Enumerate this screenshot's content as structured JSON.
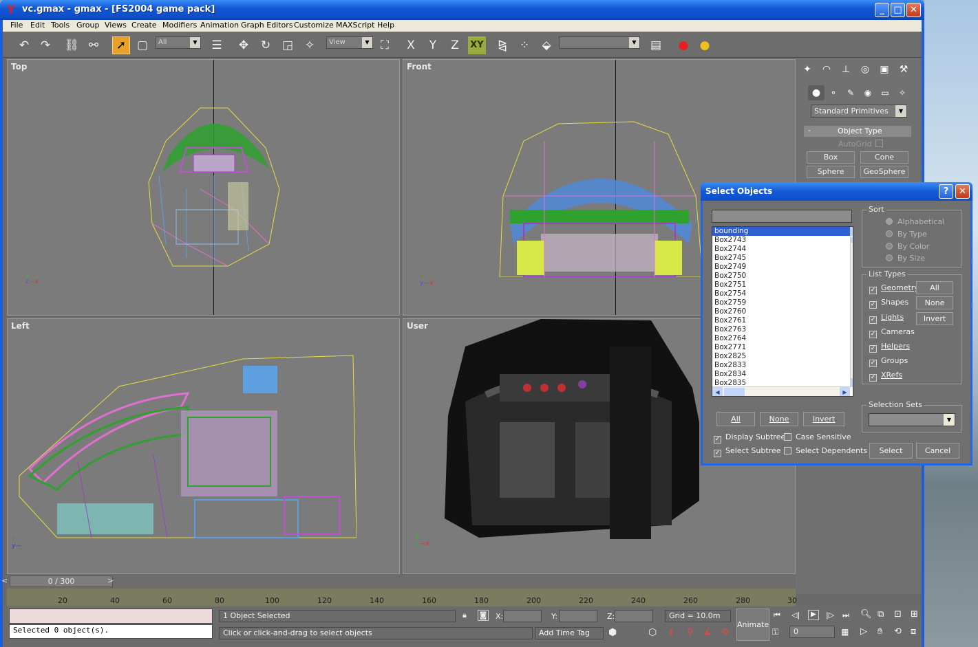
{
  "window": {
    "title": "vc.gmax - gmax - [FS2004 game pack]",
    "min_glyph": "_",
    "max_glyph": "□",
    "close_glyph": "✕"
  },
  "menu": [
    "File",
    "Edit",
    "Tools",
    "Group",
    "Views",
    "Create",
    "Modifiers",
    "Animation",
    "Graph Editors",
    "Customize",
    "MAXScript",
    "Help"
  ],
  "toolbar": {
    "selection_filter": "All",
    "reference_coord": "View",
    "named_selection": "",
    "axis_x": "X",
    "axis_y": "Y",
    "axis_z": "Z",
    "axis_xy": "XY"
  },
  "viewports": {
    "top": "Top",
    "front": "Front",
    "left": "Left",
    "user": "User"
  },
  "command_panel": {
    "category": "Standard Primitives",
    "rollout_toggle": "-",
    "rollout_title": "Object Type",
    "autogrid": "AutoGrid",
    "buttons": [
      "Box",
      "Cone",
      "Sphere",
      "GeoSphere"
    ]
  },
  "timeline": {
    "slider": "0 / 300",
    "ticks": [
      "20",
      "40",
      "60",
      "80",
      "100",
      "120",
      "140",
      "160",
      "180",
      "200",
      "220",
      "240",
      "260",
      "280",
      "30"
    ]
  },
  "status": {
    "maxscript_output": "Selected 0 object(s).",
    "selection_count": "1 Object Selected",
    "prompt": "Click or click-and-drag to select objects",
    "x_label": "X:",
    "y_label": "Y:",
    "z_label": "Z:",
    "grid": "Grid = 10.0m",
    "add_time_tag": "Add Time Tag",
    "animate": "Animate",
    "frame": "0"
  },
  "dialog": {
    "title": "Select Objects",
    "help_glyph": "?",
    "close_glyph": "✕",
    "search_value": "",
    "items": [
      "bounding",
      "Box2743",
      "Box2744",
      "Box2745",
      "Box2749",
      "Box2750",
      "Box2751",
      "Box2754",
      "Box2759",
      "Box2760",
      "Box2761",
      "Box2763",
      "Box2764",
      "Box2771",
      "Box2825",
      "Box2833",
      "Box2834",
      "Box2835"
    ],
    "sort": {
      "title": "Sort",
      "options": [
        "Alphabetical",
        "By Type",
        "By Color",
        "By Size"
      ]
    },
    "list_types": {
      "title": "List Types",
      "types": [
        "Geometry",
        "Shapes",
        "Lights",
        "Cameras",
        "Helpers",
        "Groups",
        "XRefs"
      ],
      "all": "All",
      "none": "None",
      "invert": "Invert"
    },
    "selection_sets": {
      "title": "Selection Sets",
      "value": ""
    },
    "list_all": "All",
    "list_none": "None",
    "list_invert": "Invert",
    "display_subtree": "Display Subtree",
    "case_sensitive": "Case Sensitive",
    "select_subtree": "Select Subtree",
    "select_dependents": "Select Dependents",
    "select": "Select",
    "cancel": "Cancel"
  }
}
